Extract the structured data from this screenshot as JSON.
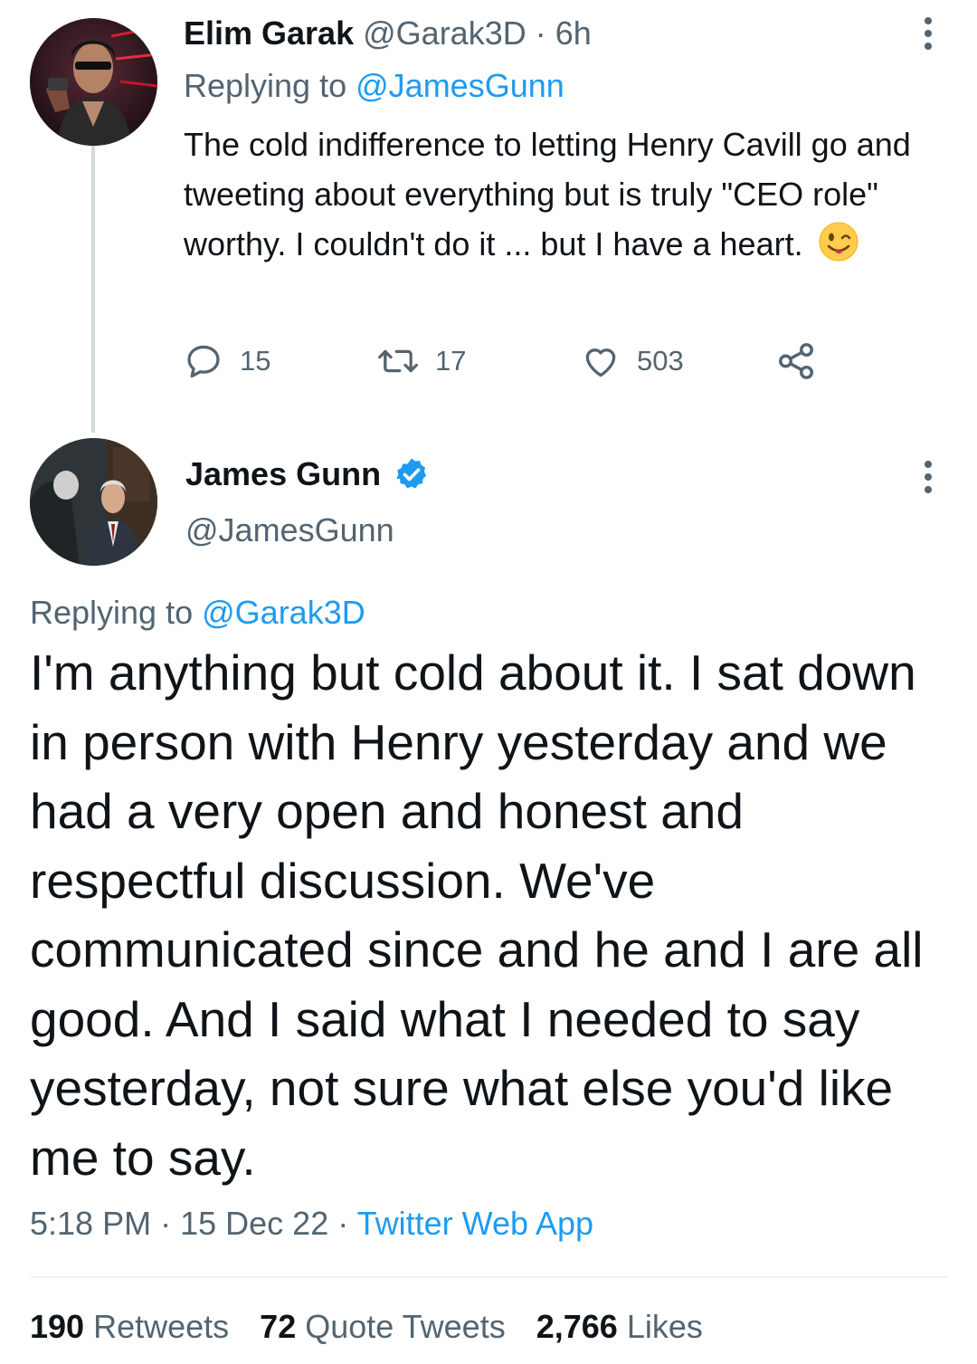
{
  "reply": {
    "author_name": "Elim Garak",
    "author_handle": "@Garak3D",
    "separator": "·",
    "time_ago": "6h",
    "replying_prefix": "Replying to",
    "replying_to": "@JamesGunn",
    "text": "The cold indifference to letting Henry Cavill go and tweeting about everything but is truly \"CEO role\" worthy. I couldn't do it ... but I have a heart.",
    "emoji": "winking-face-with-tongue",
    "actions": {
      "replies": "15",
      "retweets": "17",
      "likes": "503"
    }
  },
  "tweet": {
    "author_name": "James Gunn",
    "author_handle": "@JamesGunn",
    "verified": true,
    "replying_prefix": "Replying to",
    "replying_to": "@Garak3D",
    "text": "I'm anything but cold about it. I sat down in person with Henry yesterday and we had a very open and honest and respectful discussion. We've communicated since and he and I are all good. And I said what I needed to say yesterday, not sure what else you'd like me to say.",
    "time": "5:18 PM",
    "separator": "·",
    "date": "15 Dec 22",
    "source": "Twitter Web App",
    "stats": {
      "retweets_count": "190",
      "retweets_label": "Retweets",
      "quotes_count": "72",
      "quotes_label": "Quote Tweets",
      "likes_count": "2,766",
      "likes_label": "Likes"
    }
  },
  "colors": {
    "accent": "#1d9bf0",
    "muted": "#536471",
    "text": "#0f1419",
    "thread_line": "#cfd9de"
  }
}
